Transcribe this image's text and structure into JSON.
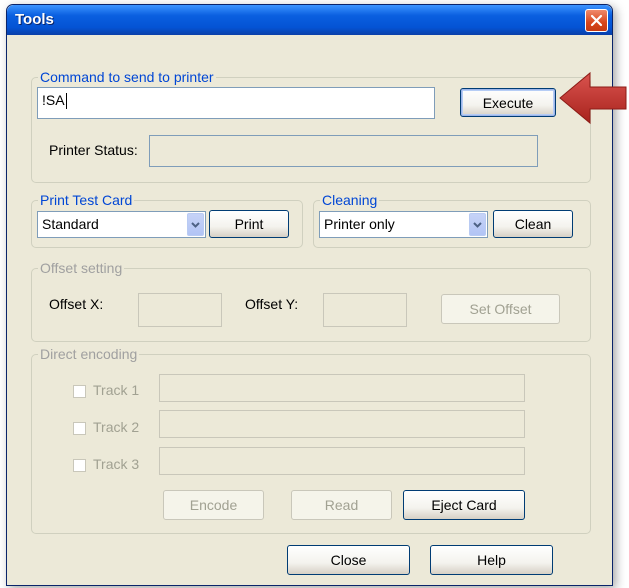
{
  "window": {
    "title": "Tools"
  },
  "command_group": {
    "legend": "Command to send to printer",
    "command_value": "!SA",
    "execute_label": "Execute",
    "status_label": "Printer Status:",
    "status_value": ""
  },
  "print_test_group": {
    "legend": "Print Test Card",
    "selected": "Standard",
    "print_label": "Print"
  },
  "cleaning_group": {
    "legend": "Cleaning",
    "selected": "Printer only",
    "clean_label": "Clean"
  },
  "offset_group": {
    "legend": "Offset setting",
    "offset_x_label": "Offset X:",
    "offset_y_label": "Offset Y:",
    "offset_x_value": "",
    "offset_y_value": "",
    "set_offset_label": "Set Offset"
  },
  "encoding_group": {
    "legend": "Direct encoding",
    "tracks": [
      {
        "label": "Track 1",
        "value": ""
      },
      {
        "label": "Track 2",
        "value": ""
      },
      {
        "label": "Track 3",
        "value": ""
      }
    ],
    "encode_label": "Encode",
    "read_label": "Read",
    "eject_label": "Eject Card"
  },
  "footer": {
    "close_label": "Close",
    "help_label": "Help"
  },
  "colors": {
    "title_bar": "#0453d4",
    "group_legend": "#0046d5",
    "callout_arrow": "#c0392b",
    "dialog_bg": "#ece9d8"
  }
}
